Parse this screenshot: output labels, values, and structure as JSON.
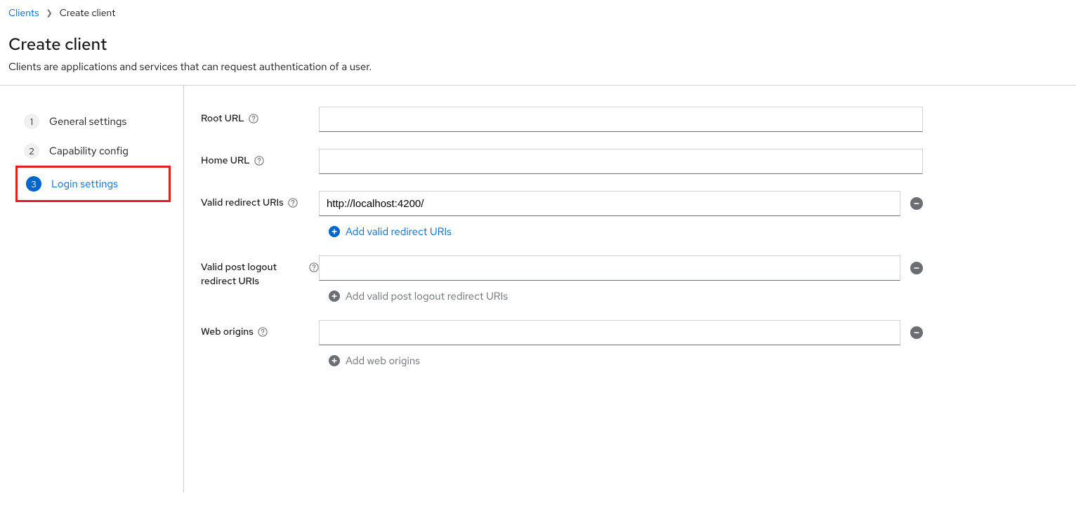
{
  "breadcrumb": {
    "parent": "Clients",
    "current": "Create client"
  },
  "header": {
    "title": "Create client",
    "description": "Clients are applications and services that can request authentication of a user."
  },
  "wizard": {
    "steps": [
      {
        "num": "1",
        "label": "General settings"
      },
      {
        "num": "2",
        "label": "Capability config"
      },
      {
        "num": "3",
        "label": "Login settings"
      }
    ]
  },
  "form": {
    "root_url": {
      "label": "Root URL",
      "value": ""
    },
    "home_url": {
      "label": "Home URL",
      "value": ""
    },
    "redirect": {
      "label": "Valid redirect URIs",
      "value": "http://localhost:4200/",
      "add_label": "Add valid redirect URIs"
    },
    "post_logout": {
      "label": "Valid post logout redirect URIs",
      "value": "",
      "add_label": "Add valid post logout redirect URIs"
    },
    "web_origins": {
      "label": "Web origins",
      "value": "",
      "add_label": "Add web origins"
    }
  }
}
